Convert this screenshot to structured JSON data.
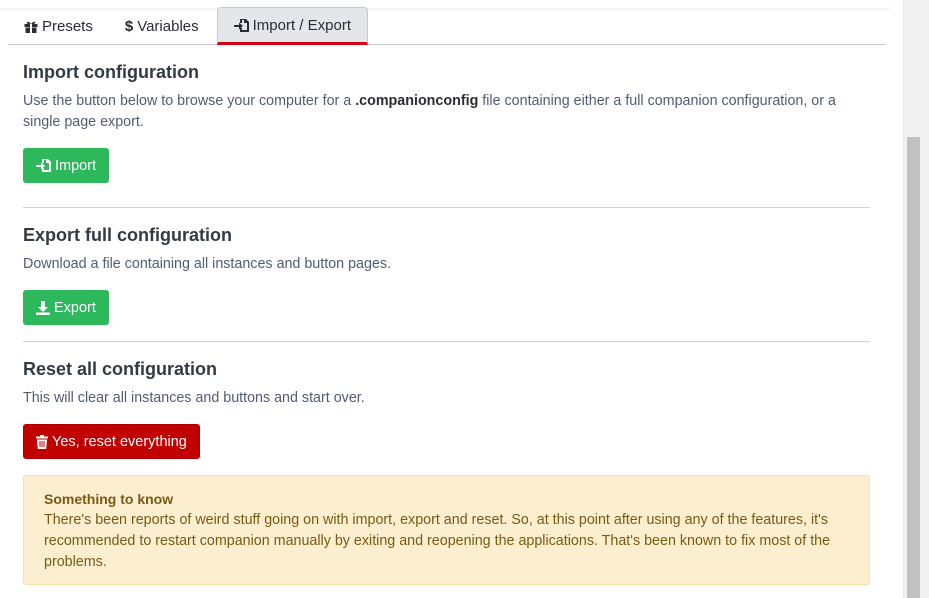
{
  "tabs": [
    {
      "label": "Presets",
      "icon": "gift-icon"
    },
    {
      "label": "Variables",
      "icon": "dollar-icon"
    },
    {
      "label": "Import / Export",
      "icon": "file-import-icon",
      "active": true
    }
  ],
  "import_section": {
    "title": "Import configuration",
    "desc_before": "Use the button below to browse your computer for a ",
    "desc_bold": ".companionconfig",
    "desc_after": " file containing either a full companion configuration, or a single page export.",
    "button_label": "Import"
  },
  "export_section": {
    "title": "Export full configuration",
    "desc": "Download a file containing all instances and button pages.",
    "button_label": "Export"
  },
  "reset_section": {
    "title": "Reset all configuration",
    "desc": "This will clear all instances and buttons and start over.",
    "button_label": "Yes, reset everything"
  },
  "alert": {
    "title": "Something to know",
    "body": "There's been reports of weird stuff going on with import, export and reset. So, at this point after using any of the features, it's recommended to restart companion manually by exiting and reopening the applications. That's been known to fix most of the problems."
  },
  "colors": {
    "success": "#2eb85c",
    "danger": "#c10000",
    "active_tab_underline": "#d0021b",
    "warning_bg": "#fcefd0"
  }
}
